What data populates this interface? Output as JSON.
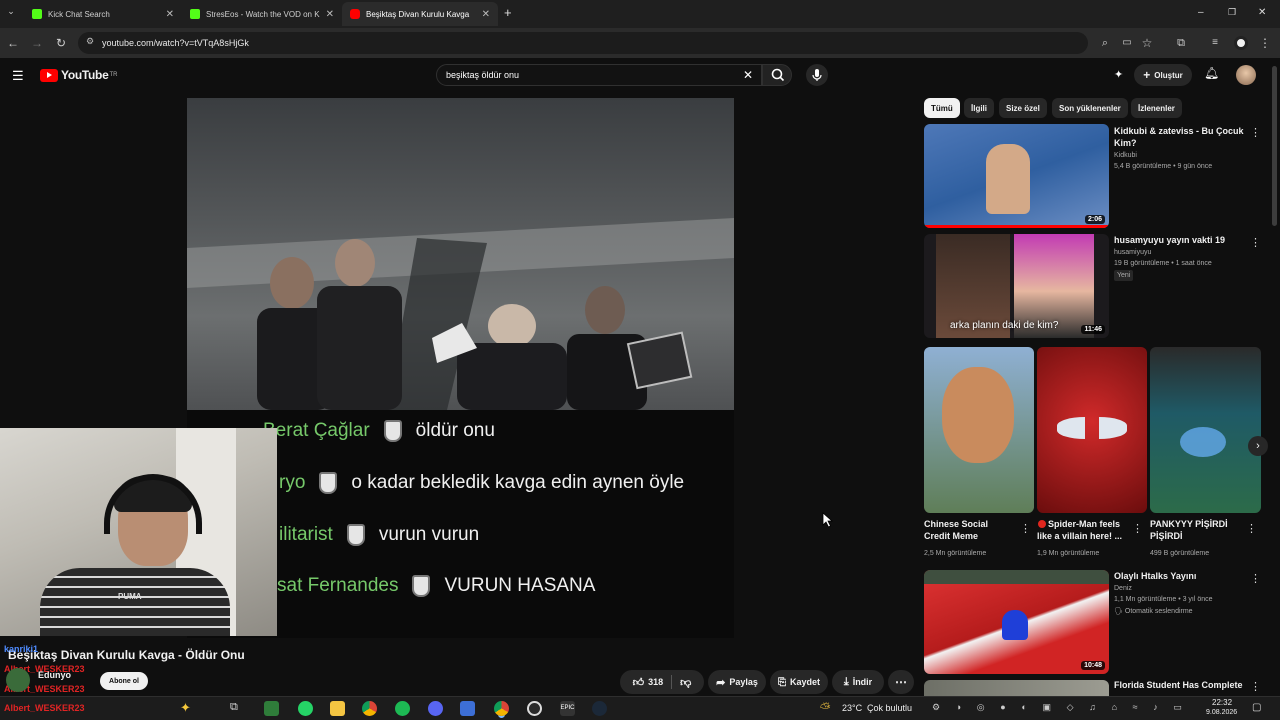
{
  "browser": {
    "tabs": [
      {
        "title": "Kick Chat Search"
      },
      {
        "title": "StresEos - Watch the VOD on Kick"
      },
      {
        "title": "Beşiktaş Divan Kurulu Kavga"
      }
    ],
    "new_tab": "+",
    "url": "youtube.com/watch?v=tVTqA8sHjGk",
    "window_controls": {
      "minimize": "–",
      "restore": "❐",
      "close": "✕"
    }
  },
  "youtube": {
    "logo_text": "YouTube",
    "logo_region": "TR",
    "search_query": "beşiktaş öldür onu",
    "create_label": "Oluştur"
  },
  "video": {
    "title": "Beşiktaş Divan Kurulu Kavga - Öldür Onu",
    "chat_lines": [
      {
        "name": "Berat Çağlar",
        "msg": "öldür onu"
      },
      {
        "name": "ryo",
        "msg": "o kadar bekledik kavga edin aynen öyle"
      },
      {
        "name": "ilitarist",
        "msg": "vurun vurun"
      },
      {
        "name": "sat Fernandes",
        "msg": "VURUN HASANA"
      }
    ],
    "actions": {
      "likes": "318",
      "share": "Paylaş",
      "save": "Kaydet",
      "download": "İndir"
    }
  },
  "channel": {
    "name": "Edunyo",
    "subscribe": "Abone ol"
  },
  "stream_overlay": {
    "users": [
      "kanriki1",
      "Albert_WESKER23",
      "Albert_WESKER23",
      "Albert_WESKER23"
    ],
    "webcam_shirt_text": "PUMA"
  },
  "sidebar": {
    "chips": [
      "Tümü",
      "İlgili",
      "Size özel",
      "Son yüklenenler",
      "İzlenenler"
    ],
    "videos": [
      {
        "title": "Kidkubi & zateviss - Bu Çocuk Kim?",
        "channel": "Kidkubi",
        "meta": "5,4 B görüntüleme • 9 gün önce",
        "duration": "2:06"
      },
      {
        "title": "husamyuyu yayın vakti 19",
        "channel": "husamiyuyu",
        "meta": "19 B görüntüleme • 1 saat önce",
        "badge": "Yeni",
        "duration": "11:46",
        "thumb_caption": "arka planın daki de kim?"
      },
      {
        "title": "Olaylı Htalks Yayını",
        "channel": "Deniz",
        "meta": "1,1 Mn görüntüleme • 3 yıl önce",
        "badge": "Otomatik seslendirme",
        "duration": "10:48"
      },
      {
        "title": "Florida Student Has Complete"
      }
    ],
    "shorts": [
      {
        "title": "Chinese Social Credit Meme",
        "views": "2,5 Mn görüntüleme"
      },
      {
        "title": "Spider-Man feels like a villain here! ...",
        "views": "1,9 Mn görüntüleme"
      },
      {
        "title": "PANKYYY PİŞİRDİ PİŞİRDİ",
        "views": "499 B görüntüleme"
      }
    ]
  },
  "taskbar": {
    "weather": "23°C",
    "weather_desc": "Çok bulutlu",
    "time": "22:32",
    "date": "9.08.2026"
  },
  "colors": {
    "youtube_red": "#ff0000",
    "chat_name": "#76c96a",
    "overlay_red": "#e02424"
  }
}
